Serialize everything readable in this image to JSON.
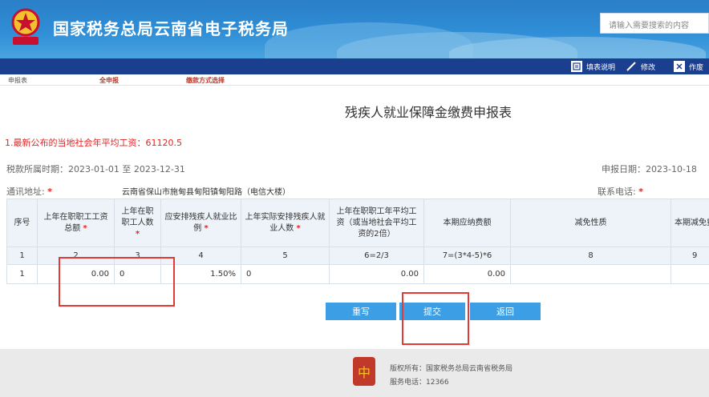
{
  "header": {
    "site_title": "国家税务总局云南省电子税务局",
    "emblem_text": "中国税务",
    "search_placeholder": "请输入需要搜索的内容"
  },
  "toolbar": {
    "fill_help": "填表说明",
    "edit": "修改",
    "void": "作废"
  },
  "tabs": [
    "申报表",
    "全申报",
    "缴款方式选择"
  ],
  "form": {
    "title": "残疾人就业保障金缴费申报表",
    "notice": "1.最新公布的当地社会年平均工资：61120.5",
    "period": "税款所属时期：2023-01-01 至 2023-12-31",
    "declaration_date": "申报日期：2023-10-18",
    "address_label": "通讯地址:",
    "address_value": "云南省保山市施甸县甸阳镇甸阳路（电信大楼）",
    "phone_label": "联系电话:",
    "required_mark": "*"
  },
  "table": {
    "headers": [
      {
        "text": "序号",
        "required": false
      },
      {
        "text": "上年在职职工工资总额",
        "required": true
      },
      {
        "text": "上年在职职工人数",
        "required": true
      },
      {
        "text": "应安排残疾人就业比例",
        "required": true
      },
      {
        "text": "上年实际安排残疾人就业人数",
        "required": true
      },
      {
        "text": "上年在职职工年平均工资（或当地社会平均工资的2倍）",
        "required": false
      },
      {
        "text": "本期应纳费额",
        "required": false
      },
      {
        "text": "减免性质",
        "required": false
      },
      {
        "text": "本期减免费",
        "required": false
      }
    ],
    "index_row": [
      "1",
      "2",
      "3",
      "4",
      "5",
      "6=2/3",
      "7=(3*4-5)*6",
      "8",
      "9"
    ],
    "data_row": [
      "1",
      "0.00",
      "0",
      "1.50%",
      "0",
      "0.00",
      "0.00",
      "",
      ""
    ]
  },
  "buttons": {
    "reset": "重写",
    "submit": "提交",
    "back": "返回"
  },
  "footer": {
    "copyright": "版权所有：国家税务总局云南省税务局",
    "hotline": "服务电话：12366",
    "logo_text": "中"
  },
  "colors": {
    "header_blue": "#2f8ed6",
    "toolbar_navy": "#1b3f8f",
    "button_blue": "#3c9ee4",
    "alert_red": "#e02424",
    "highlight_box": "#e53935"
  }
}
